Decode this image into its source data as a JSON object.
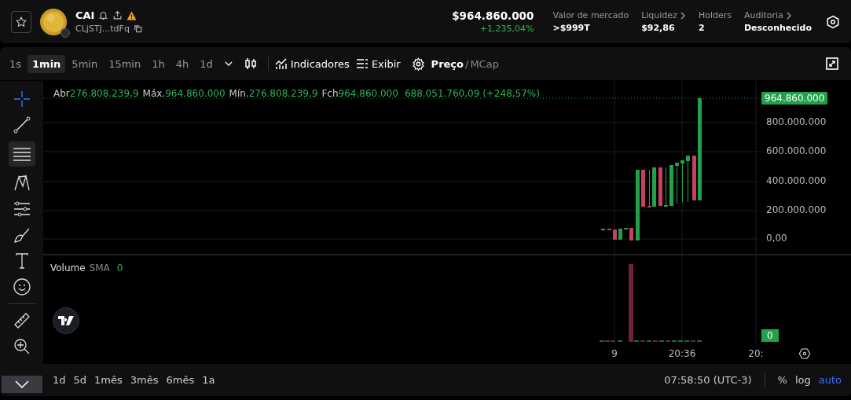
{
  "token": {
    "symbol": "CAI",
    "address": "CLjSTJ...tdFq",
    "price": "$964.860.000",
    "change": "+1,235,04%"
  },
  "stats": [
    {
      "label": "Valor de mercado",
      "value": ">$999T",
      "arrow": false
    },
    {
      "label": "Liquidez",
      "value": "$92,86",
      "arrow": true
    },
    {
      "label": "Holders",
      "value": "2",
      "arrow": false
    },
    {
      "label": "Auditoria",
      "value": "Desconhecido",
      "arrow": true
    }
  ],
  "intervals": [
    {
      "label": "1s",
      "selected": false
    },
    {
      "label": "1min",
      "selected": true
    },
    {
      "label": "5min",
      "selected": false
    },
    {
      "label": "15min",
      "selected": false
    },
    {
      "label": "1h",
      "selected": false
    },
    {
      "label": "4h",
      "selected": false
    },
    {
      "label": "1d",
      "selected": false
    }
  ],
  "toolbar": {
    "indicators": "Indicadores",
    "display": "Exibir",
    "price_modes": [
      {
        "label": "Preço",
        "selected": true
      },
      {
        "label": "MCap",
        "selected": false
      }
    ],
    "separator": "/"
  },
  "legend": [
    {
      "label": "Abr",
      "value": "276.808.239,9"
    },
    {
      "label": "Máx.",
      "value": "964.860.000"
    },
    {
      "label": "Mín.",
      "value": "276.808.239,9"
    },
    {
      "label": "Fch",
      "value": "964.860.000"
    }
  ],
  "legend_change": "688.051.760,09 (+248,57%)",
  "price_axis": {
    "ticks": [
      "800.000.000",
      "600.000.000",
      "400.000.000",
      "200.000.000",
      "0,00"
    ],
    "last_price": "964.860.000"
  },
  "volume": {
    "title": "Volume",
    "indicator": "SMA",
    "value": "0",
    "last_value": "0"
  },
  "time_axis": [
    "9",
    "20:36",
    "20:"
  ],
  "ranges": [
    "1d",
    "5d",
    "1mês",
    "3mês",
    "6mês",
    "1a"
  ],
  "clock": "07:58:50 (UTC-3)",
  "scale_options": [
    {
      "label": "%",
      "selected": false
    },
    {
      "label": "log",
      "selected": false
    },
    {
      "label": "auto",
      "selected": true
    }
  ]
}
